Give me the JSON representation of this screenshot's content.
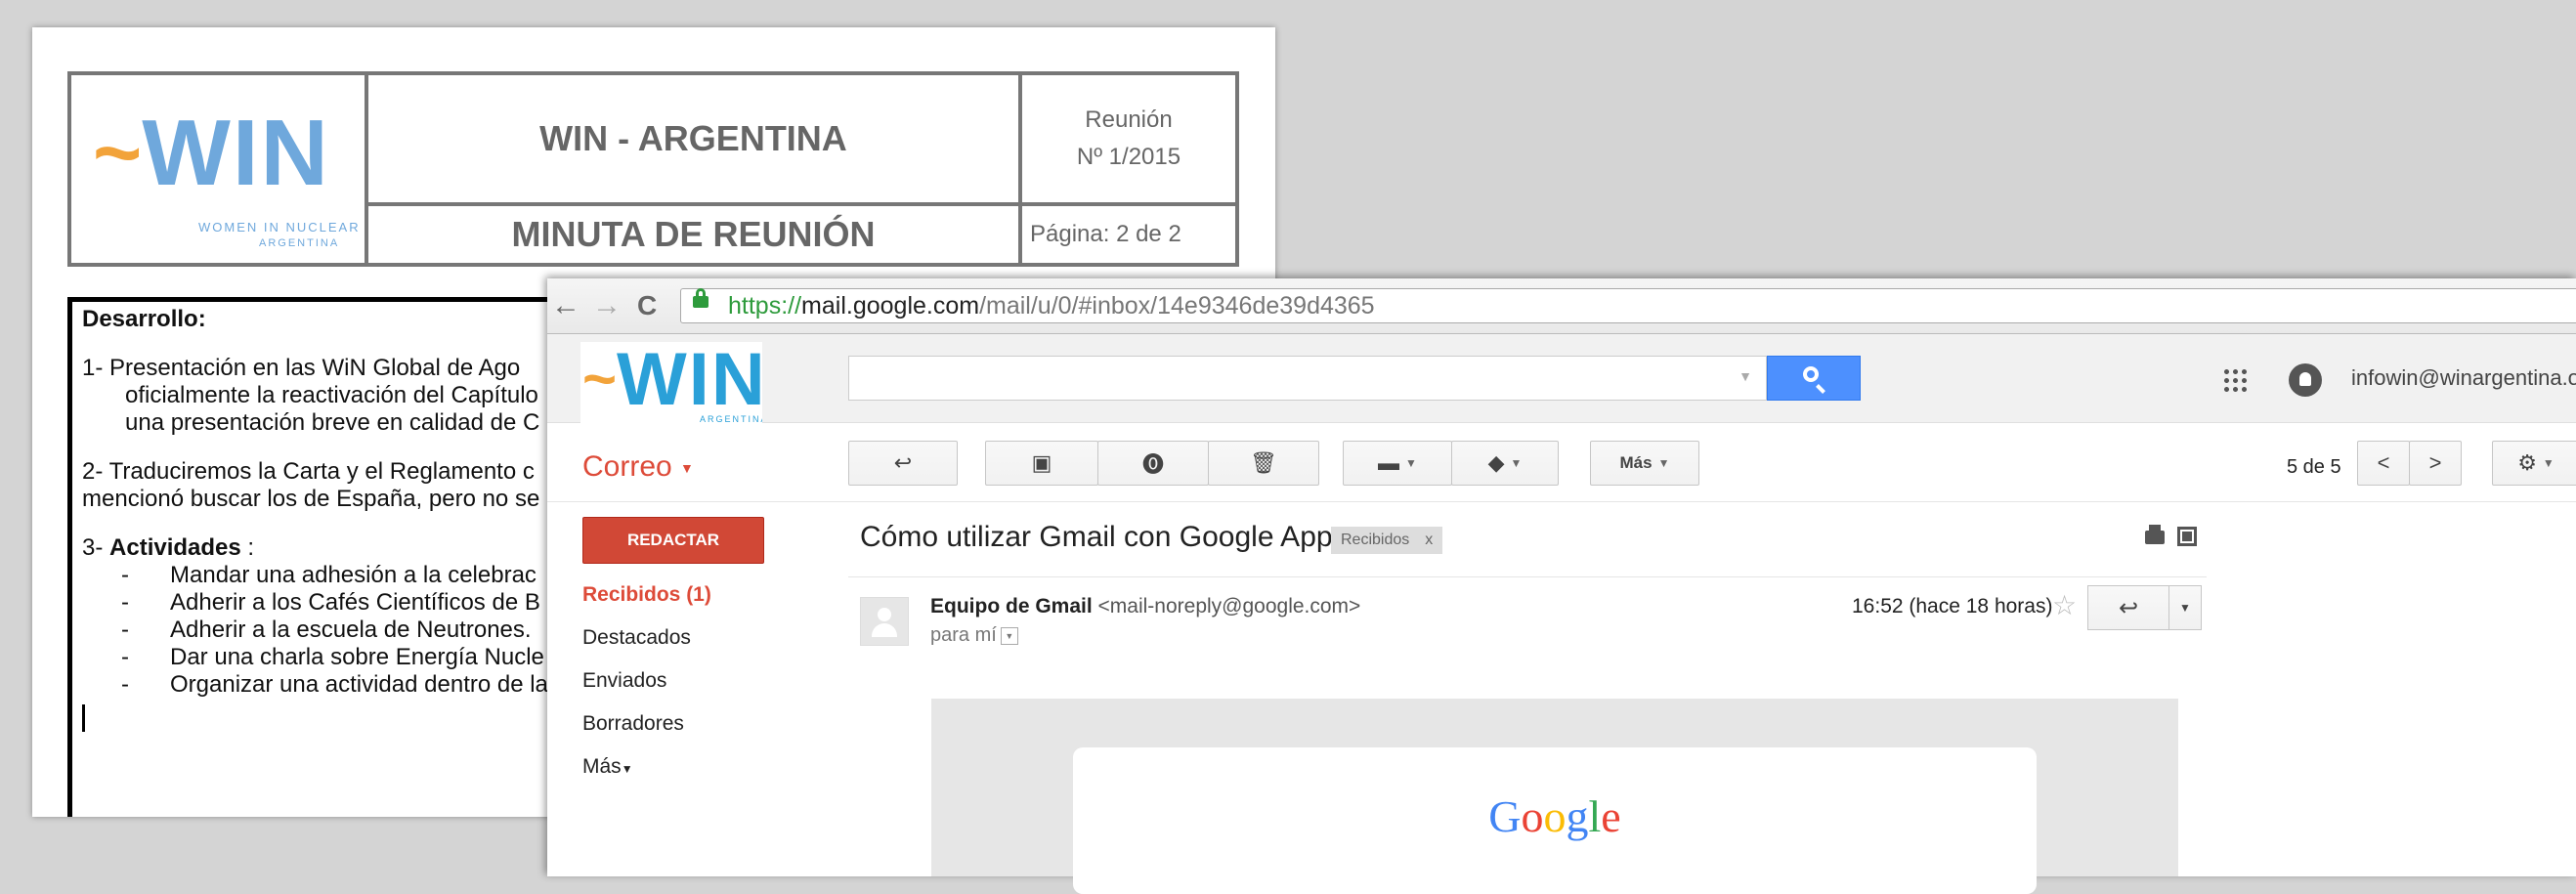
{
  "document": {
    "logo": {
      "word": "WIN",
      "tagline_1": "WOMEN IN NUCLEAR",
      "tagline_2": "ARGENTINA"
    },
    "header_title": "WIN - ARGENTINA",
    "header_subtitle": "MINUTA DE REUNIÓN",
    "meeting_label": "Reunión",
    "meeting_number": "Nº 1/2015",
    "page_label": "Página: 2 de 2",
    "section_title": "Desarrollo:",
    "item1_line1": "1-   Presentación en las WiN Global de Ago",
    "item1_line2": "oficialmente la reactivación del Capítulo",
    "item1_line3": "una presentación breve en calidad de C",
    "item2_line1": "2- Traduciremos la  Carta y el Reglamento c",
    "item2_line2": "mencionó buscar los de España, pero no se",
    "item3_prefix": "3-",
    "item3_title": "Actividades",
    "item3_colon": " :",
    "activities": [
      " Mandar una adhesión a la celebrac",
      "Adherir a los Cafés Científicos de B",
      "Adherir a la escuela de Neutrones.",
      "Dar una charla sobre Energía Nucle",
      "Organizar una actividad dentro de la"
    ]
  },
  "browser": {
    "back_glyph": "←",
    "forward_glyph": "→",
    "reload_glyph": "C",
    "url_scheme": "https://",
    "url_host": "mail.google.com",
    "url_path": "/mail/u/0/#inbox/14e9346de39d4365"
  },
  "gmail": {
    "logo": {
      "word": "WIN",
      "tagline": "ARGENTINA"
    },
    "search_value": "",
    "account_email": "infowin@winargentina.org",
    "mail_label": "Correo",
    "toolbar": {
      "more_label": "Más"
    },
    "pager_text": "5 de 5",
    "compose_label": "REDACTAR",
    "nav": {
      "inbox": "Recibidos (1)",
      "starred": "Destacados",
      "sent": "Enviados",
      "drafts": "Borradores",
      "more": "Más"
    },
    "message": {
      "subject": "Cómo utilizar Gmail con Google Apps",
      "label_chip": "Recibidos",
      "label_remove": "x",
      "sender_name": "Equipo de Gmail",
      "sender_address": "<mail-noreply@google.com>",
      "recipient": "para mí",
      "timestamp": "16:52 (hace 18 horas)",
      "body_logo": "Google"
    }
  }
}
